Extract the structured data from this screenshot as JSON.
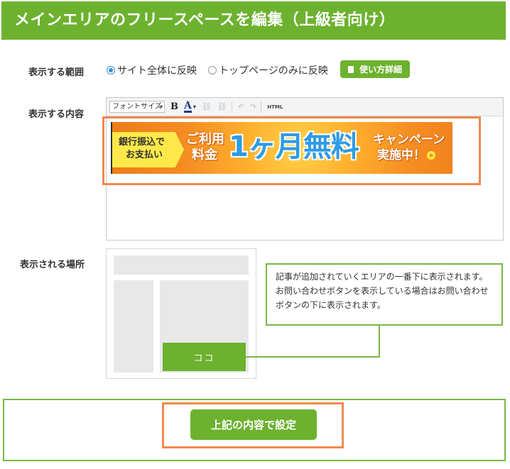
{
  "header": {
    "title": "メインエリアのフリースペースを編集（上級者向け）"
  },
  "range": {
    "label": "表示する範囲",
    "options": [
      {
        "label": "サイト全体に反映",
        "checked": true
      },
      {
        "label": "トップページのみに反映",
        "checked": false
      }
    ],
    "help_label": "使い方詳細"
  },
  "content": {
    "label": "表示する内容",
    "toolbar": {
      "font_size_label": "フォントサイズ",
      "bold": "B",
      "font_color": "A",
      "html": "HTML"
    },
    "banner": {
      "left_text_line1": "銀行振込で",
      "left_text_line2": "お支払い",
      "mid_line1": "ご利用",
      "mid_line2": "料金",
      "big_text": "1ヶ月無料",
      "right_line1": "キャンペーン",
      "right_line2": "実施中！"
    }
  },
  "location": {
    "label": "表示される場所",
    "marker": "ココ",
    "description": "記事が追加されていくエリアの一番下に表示されます。お問い合わせボタンを表示している場合はお問い合わせボタンの下に表示されます。"
  },
  "submit": {
    "label": "上記の内容で設定"
  },
  "colors": {
    "brand_green": "#6db22f",
    "highlight_orange": "#f0894f",
    "radio_blue": "#3a8fd8"
  }
}
